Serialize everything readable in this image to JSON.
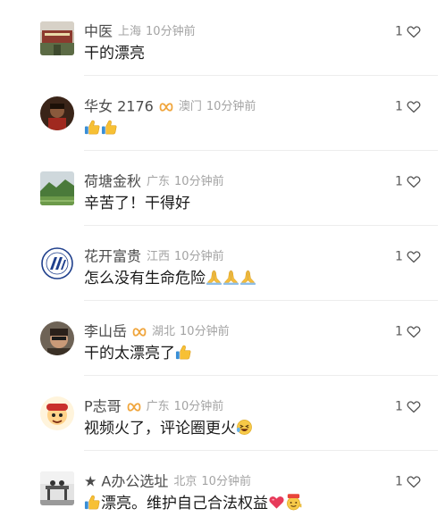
{
  "colors": {
    "name": "#4a4a4a",
    "meta": "#a3a3a3",
    "text": "#1a1a1a",
    "badge": "#f0a53c",
    "heart_outline": "#555555",
    "divider": "#ededed"
  },
  "comments": [
    {
      "avatar": "photo-building",
      "name": "中医",
      "fan_badge": false,
      "region": "上海",
      "time": "10分钟前",
      "segments": [
        {
          "t": "text",
          "v": "干的漂亮"
        }
      ],
      "likes": "1"
    },
    {
      "avatar": "photo-person",
      "name": "华女 2176",
      "fan_badge": true,
      "region": "澳门",
      "time": "10分钟前",
      "segments": [
        {
          "t": "emoji",
          "v": "thumbs-up-emoji"
        },
        {
          "t": "emoji",
          "v": "thumbs-up-emoji"
        }
      ],
      "likes": "1"
    },
    {
      "avatar": "photo-landscape",
      "name": "荷塘金秋",
      "fan_badge": false,
      "region": "广东",
      "time": "10分钟前",
      "segments": [
        {
          "t": "text",
          "v": "辛苦了！干得好"
        }
      ],
      "likes": "1"
    },
    {
      "avatar": "logo-emblem",
      "name": "花开富贵",
      "fan_badge": false,
      "region": "江西",
      "time": "10分钟前",
      "segments": [
        {
          "t": "text",
          "v": "怎么没有生命危险"
        },
        {
          "t": "emoji",
          "v": "praying-hands-emoji"
        },
        {
          "t": "emoji",
          "v": "praying-hands-emoji"
        },
        {
          "t": "emoji",
          "v": "praying-hands-emoji"
        }
      ],
      "likes": "1"
    },
    {
      "avatar": "photo-man",
      "name": "李山岳",
      "fan_badge": true,
      "region": "湖北",
      "time": "10分钟前",
      "segments": [
        {
          "t": "text",
          "v": "干的太漂亮了"
        },
        {
          "t": "emoji",
          "v": "thumbs-up-emoji"
        }
      ],
      "likes": "1"
    },
    {
      "avatar": "cartoon-character",
      "name": "P志哥",
      "fan_badge": true,
      "region": "广东",
      "time": "10分钟前",
      "segments": [
        {
          "t": "text",
          "v": "视频火了，评论圈更火"
        },
        {
          "t": "emoji",
          "v": "laughing-emoji"
        }
      ],
      "likes": "1"
    },
    {
      "avatar": "photo-office",
      "name": "★ A办公选址",
      "fan_badge": false,
      "region": "北京",
      "time": "10分钟前",
      "segments": [
        {
          "t": "emoji",
          "v": "thumbs-up-emoji"
        },
        {
          "t": "text",
          "v": "漂亮。维护自己合法权益"
        },
        {
          "t": "emoji",
          "v": "red-heart-emoji"
        },
        {
          "t": "emoji",
          "v": "666-emoji"
        }
      ],
      "likes": "1"
    }
  ]
}
